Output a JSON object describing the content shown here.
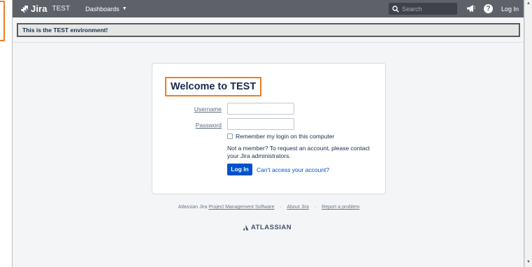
{
  "nav": {
    "logo_text": "Jira",
    "env_label": "TEST",
    "dashboards_label": "Dashboards",
    "search_placeholder": "Search",
    "login_label": "Log In"
  },
  "banner": {
    "text": "This is the TEST environment!"
  },
  "login": {
    "title": "Welcome to TEST",
    "username_label": "Username",
    "password_label": "Password",
    "username_value": "",
    "password_value": "",
    "remember_label": "Remember my login on this computer",
    "member_text": "Not a member? To request an account, please contact your Jira administrators.",
    "login_button": "Log In",
    "cant_access": "Can't access your account?"
  },
  "footer": {
    "prefix": "Atlassian Jira",
    "pms_link": "Project Management Software",
    "about_link": "About Jira",
    "report_link": "Report a problem",
    "separator": "·",
    "brand": "ATLASSIAN"
  },
  "colors": {
    "nav_bg": "#5e6268",
    "accent_orange": "#f07c23",
    "primary_blue": "#0052cc",
    "page_bg": "#f4f5f7"
  }
}
